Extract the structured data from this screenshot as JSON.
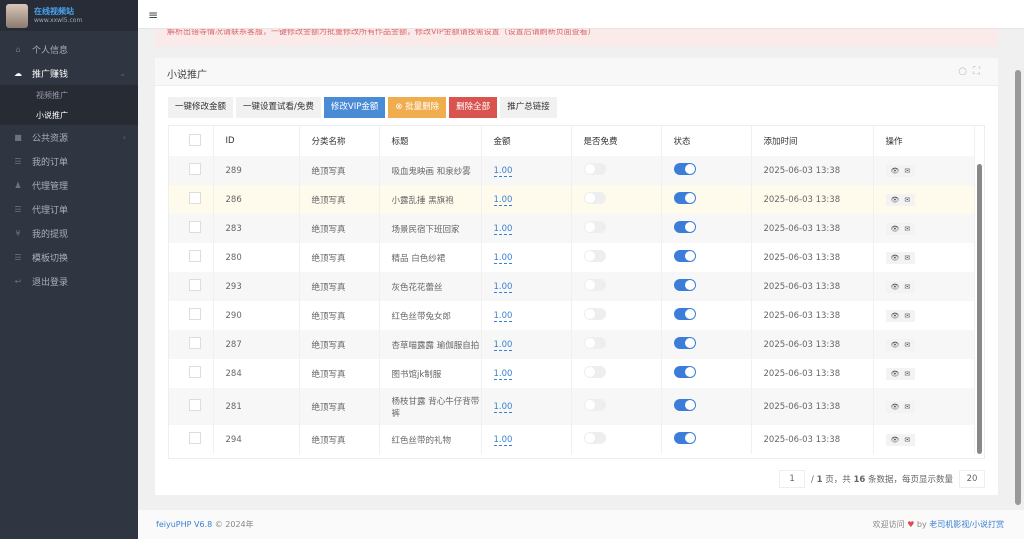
{
  "sidebar": {
    "logo": "在线视频站",
    "logo_sub": "www.xxwl5.com",
    "items": [
      {
        "label": "个人信息",
        "icon": "home-icon"
      },
      {
        "label": "推广赚钱",
        "icon": "cloud-icon",
        "active": true,
        "sub": [
          {
            "label": "视频推广"
          },
          {
            "label": "小说推广",
            "active": true
          }
        ]
      },
      {
        "label": "公共资源",
        "icon": "video-icon"
      },
      {
        "label": "我的订单",
        "icon": "list-icon"
      },
      {
        "label": "代理管理",
        "icon": "users-icon"
      },
      {
        "label": "代理订单",
        "icon": "list-icon"
      },
      {
        "label": "我的提现",
        "icon": "yen-icon"
      },
      {
        "label": "模板切换",
        "icon": "list-icon"
      },
      {
        "label": "退出登录",
        "icon": "reply-icon"
      }
    ]
  },
  "notice": "解析出错等情况请联系客服，一键修改金额为批量修改所有作品金额，修改VIP金额请按需设置（设置后请刷新页面查看）",
  "card": {
    "title": "小说推广"
  },
  "toolbar": {
    "edit_amount": "一键修改金额",
    "set_trial": "一键设置试看/免费",
    "edit_vip": "修改VIP金额",
    "batch_delete": "⊗ 批量删除",
    "delete_all": "删除全部",
    "promo_link": "推广总链接"
  },
  "table": {
    "columns": [
      "ID",
      "分类名称",
      "标题",
      "金额",
      "是否免费",
      "状态",
      "添加时间",
      "操作"
    ],
    "rows": [
      {
        "id": "289",
        "category": "绝顶写真",
        "title": "吸血鬼映画 和泉纱雾",
        "amount": "1.00",
        "free": false,
        "status": true,
        "time": "2025-06-03 13:38"
      },
      {
        "id": "286",
        "category": "绝顶写真",
        "title": "小露乱捶 黑旗袍",
        "amount": "1.00",
        "free": false,
        "status": true,
        "time": "2025-06-03 13:38"
      },
      {
        "id": "283",
        "category": "绝顶写真",
        "title": "场景民宿下班回家",
        "amount": "1.00",
        "free": false,
        "status": true,
        "time": "2025-06-03 13:38"
      },
      {
        "id": "280",
        "category": "绝顶写真",
        "title": "精品 白色纱裙",
        "amount": "1.00",
        "free": false,
        "status": true,
        "time": "2025-06-03 13:38"
      },
      {
        "id": "293",
        "category": "绝顶写真",
        "title": "灰色花花蕾丝",
        "amount": "1.00",
        "free": false,
        "status": true,
        "time": "2025-06-03 13:38"
      },
      {
        "id": "290",
        "category": "绝顶写真",
        "title": "红色丝带兔女郎",
        "amount": "1.00",
        "free": false,
        "status": true,
        "time": "2025-06-03 13:38"
      },
      {
        "id": "287",
        "category": "绝顶写真",
        "title": "杏草喵露露 瑜伽服自拍",
        "amount": "1.00",
        "free": false,
        "status": true,
        "time": "2025-06-03 13:38"
      },
      {
        "id": "284",
        "category": "绝顶写真",
        "title": "图书馆jk制服",
        "amount": "1.00",
        "free": false,
        "status": true,
        "time": "2025-06-03 13:38"
      },
      {
        "id": "281",
        "category": "绝顶写真",
        "title": "杨枝甘露 背心牛仔背带裤",
        "amount": "1.00",
        "free": false,
        "status": true,
        "time": "2025-06-03 13:38"
      },
      {
        "id": "294",
        "category": "绝顶写真",
        "title": "红色丝带的礼物",
        "amount": "1.00",
        "free": false,
        "status": true,
        "time": "2025-06-03 13:38"
      }
    ]
  },
  "pager": {
    "page": "1",
    "text_pre": "/ ",
    "total_pages": "1",
    "text_mid": " 页，共 ",
    "total": "16",
    "text_post": " 条数据，每页显示数量",
    "per_page": "20"
  },
  "footer": {
    "brand": "feiyuPHP V6.8",
    "copy": " © 2024年",
    "welcome": "欢迎访问 ",
    "by": " by ",
    "author": "老司机影视/小说打赏"
  }
}
